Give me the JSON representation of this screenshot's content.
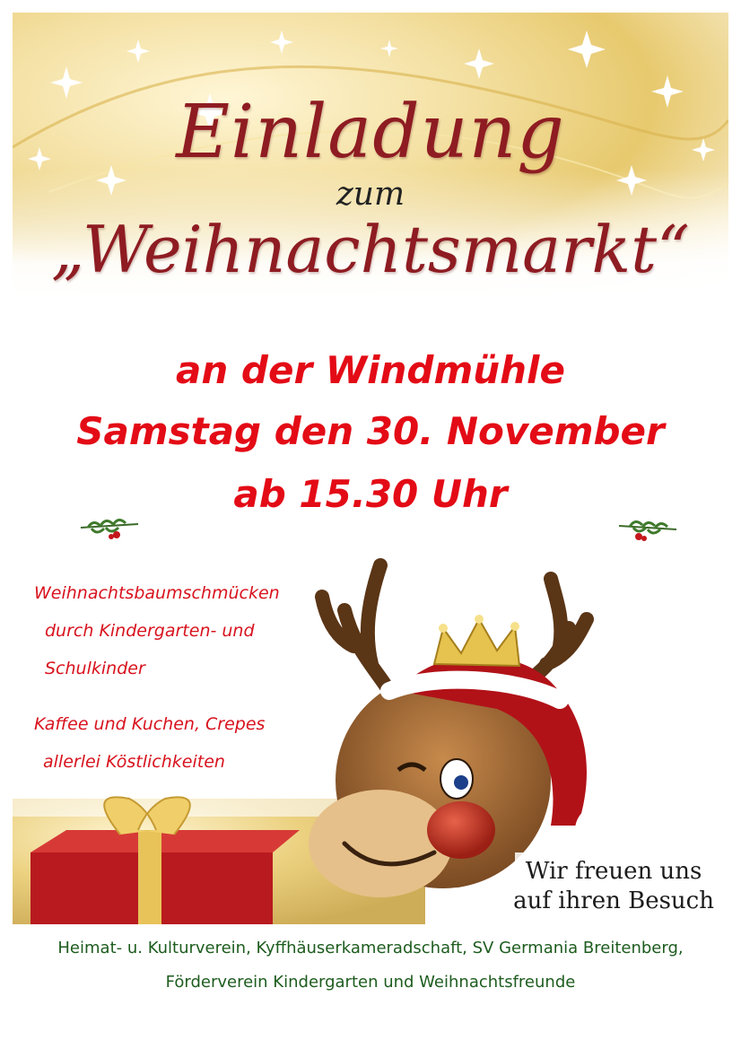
{
  "header": {
    "title": "Einladung",
    "subtitle_connector": "zum",
    "event_name": "„Weihnachtsmarkt“"
  },
  "details": {
    "location": "an der Windmühle",
    "date": "Samstag den 30. November",
    "time": "ab 15.30 Uhr"
  },
  "program": [
    "Weihnachtsbaumschmücken",
    "durch Kindergarten- und",
    "Schulkinder",
    "Kaffee und Kuchen, Crepes",
    "allerlei Köstlichkeiten"
  ],
  "greeting": {
    "line1": "Wir freuen uns",
    "line2": "auf ihren Besuch"
  },
  "footer": {
    "line1": "Heimat- u. Kulturverein, Kyffhäuserkameradschaft, SV Germania Breitenberg,",
    "line2": "Förderverein Kindergarten und Weihnachtsfreunde"
  },
  "colors": {
    "title_red": "#8e1c22",
    "event_red": "#e30b16",
    "footer_green": "#1d5c1e",
    "gold": "#e7c96e"
  },
  "icons": [
    "star-icon",
    "holly-sprig-icon",
    "reindeer-illustration",
    "gift-box-icon",
    "crown-icon"
  ]
}
